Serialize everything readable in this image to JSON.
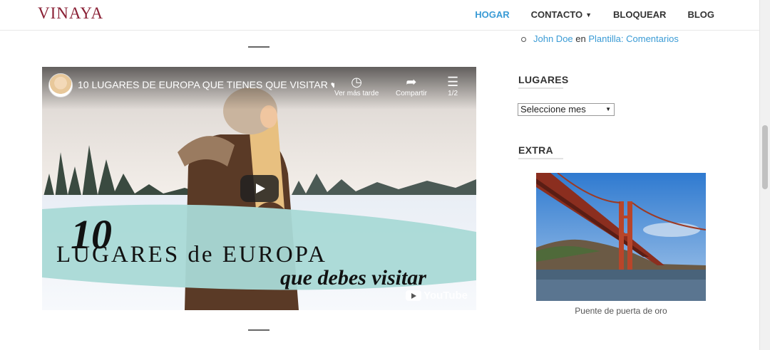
{
  "header": {
    "logo": "VINAYA",
    "nav": [
      {
        "label": "HOGAR",
        "active": true
      },
      {
        "label": "CONTACTO",
        "has_dropdown": true
      },
      {
        "label": "BLOQUEAR"
      },
      {
        "label": "BLOG"
      }
    ]
  },
  "recent_comments": {
    "author": "John Doe",
    "connector": "en",
    "post": "Plantilla: Comentarios"
  },
  "video": {
    "title": "10 LUGARES DE EUROPA QUE TIENES QUE VISITAR ♥ ...",
    "watch_later_label": "Ver más tarde",
    "share_label": "Compartir",
    "playlist_label": "1/2",
    "thumbnail_text": {
      "line1": "10",
      "line2": "LUGARES de EUROPA",
      "line3": "que debes visitar"
    },
    "provider": "YouTube"
  },
  "sidebar": {
    "lugares_title": "LUGARES",
    "archive_select_value": "Seleccione mes",
    "extra_title": "EXTRA",
    "image_caption": "Puente de puerta de oro"
  },
  "colors": {
    "brand": "#8a2035",
    "accent": "#3a9bd5"
  }
}
